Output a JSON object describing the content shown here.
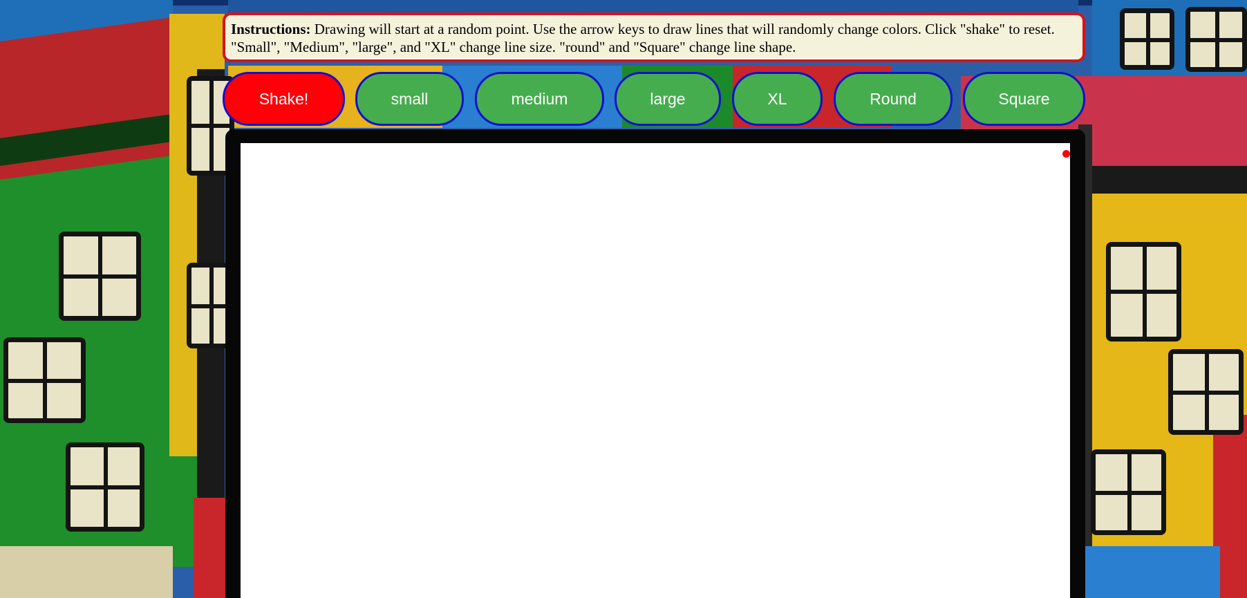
{
  "instructions": {
    "label": "Instructions:",
    "text": " Drawing will start at a random point. Use the arrow keys to draw lines that will randomly change colors. Click \"shake\" to reset. \"Small\", \"Medium\", \"large\", and \"XL\" change line size. \"round\" and \"Square\" change line shape."
  },
  "buttons": {
    "shake": "Shake!",
    "small": "small",
    "medium": "medium",
    "large": "large",
    "xl": "XL",
    "round": "Round",
    "square": "Square"
  },
  "canvas": {
    "cursor_color": "#ff0000"
  },
  "colors": {
    "shake_button": "#ff0008",
    "option_button": "#46ad4e",
    "button_border": "#1010d0",
    "instructions_border": "#d3141c",
    "instructions_background": "#f5f2dc"
  }
}
